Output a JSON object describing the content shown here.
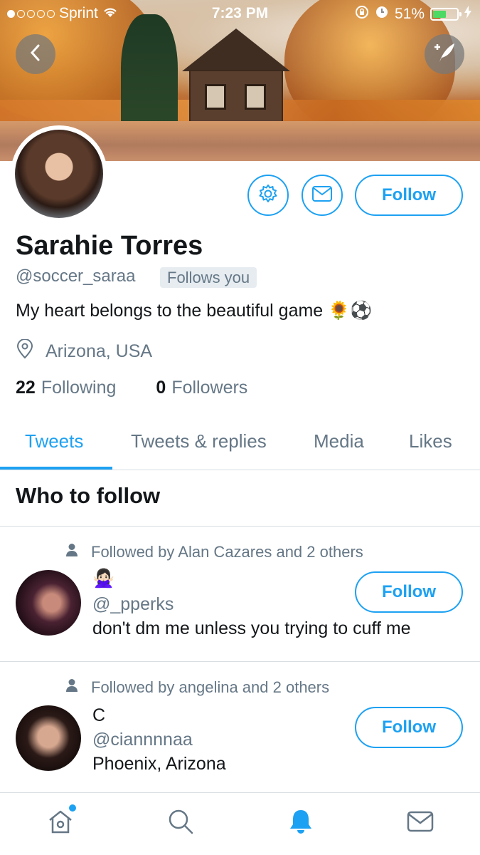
{
  "status_bar": {
    "carrier": "Sprint",
    "time": "7:23 PM",
    "battery": "51%",
    "signal_bars": 1
  },
  "profile": {
    "name": "Sarahie Torres",
    "handle": "@soccer_saraa",
    "follows_you": "Follows you",
    "bio": "My heart belongs to the beautiful game 🌻⚽",
    "location": "Arizona, USA",
    "following_count": "22",
    "following_label": "Following",
    "followers_count": "0",
    "followers_label": "Followers",
    "follow_label": "Follow"
  },
  "tabs": [
    {
      "label": "Tweets",
      "active": true
    },
    {
      "label": "Tweets & replies",
      "active": false
    },
    {
      "label": "Media",
      "active": false
    },
    {
      "label": "Likes",
      "active": false
    }
  ],
  "who_to_follow": {
    "title": "Who to follow",
    "items": [
      {
        "context": "Followed by Alan Cazares and 2 others",
        "name": "🙅🏻‍♀️",
        "handle": "@_pperks",
        "bio": "don't dm me unless you trying to cuff me",
        "follow_label": "Follow"
      },
      {
        "context": "Followed by angelina and 2 others",
        "name": "C",
        "handle": "@ciannnnaa",
        "bio": "Phoenix, Arizona",
        "follow_label": "Follow"
      }
    ]
  },
  "icons": {
    "back": "chevron-left-icon",
    "compose": "compose-tweet-icon",
    "settings": "gear-icon",
    "message": "envelope-icon",
    "location": "location-pin-icon",
    "person": "person-icon",
    "home": "home-icon",
    "search": "search-icon",
    "notifications": "bell-icon",
    "messages": "envelope-icon"
  },
  "colors": {
    "accent": "#1da1f2",
    "text_primary": "#14171a",
    "text_secondary": "#657786",
    "divider": "#d8dee2"
  }
}
